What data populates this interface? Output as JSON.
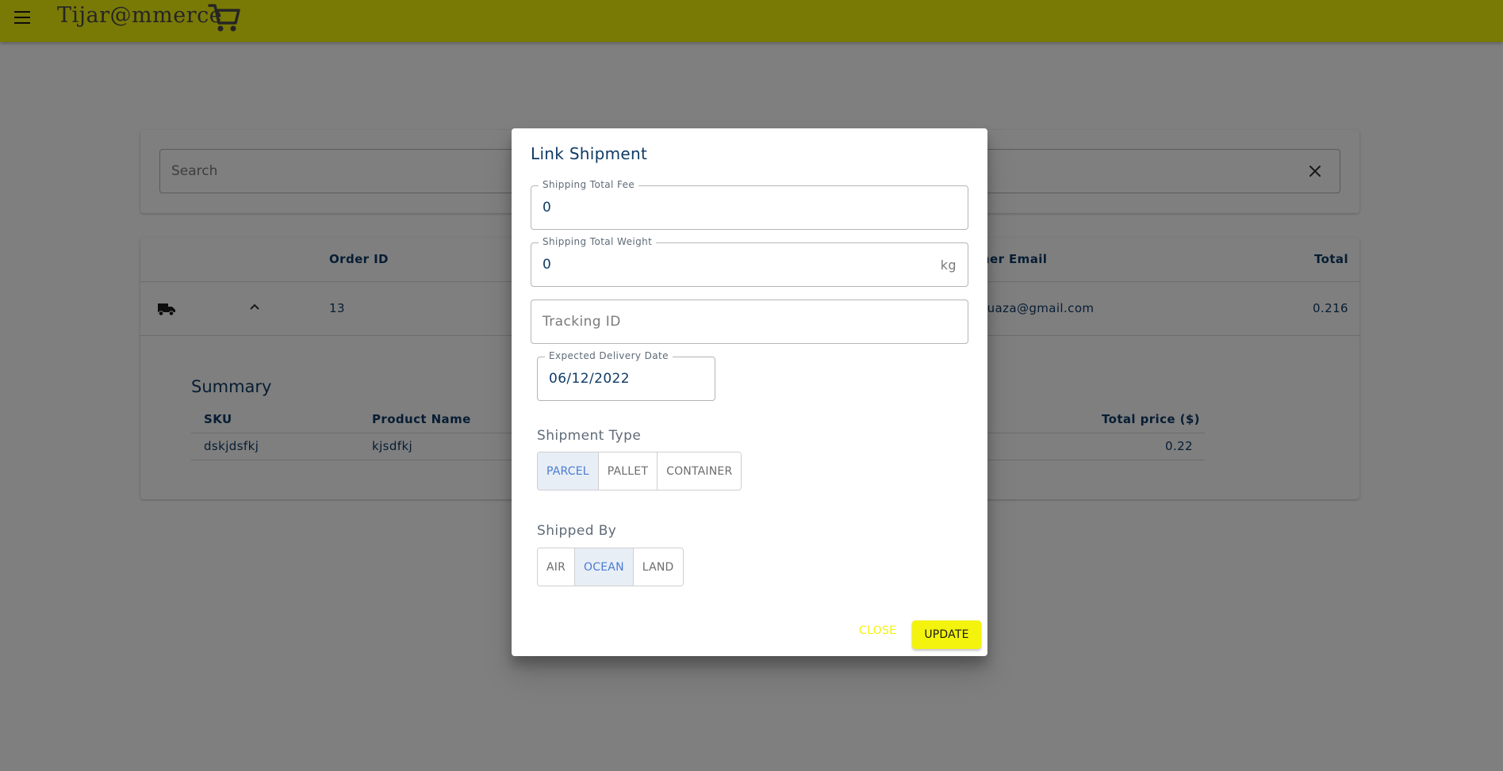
{
  "colors": {
    "brand": "#f3f30d",
    "text": "#0f3b66",
    "selected_toggle": "#4a7bd1"
  },
  "appbar": {
    "logo_text": "Tijar@mmerce",
    "menu_icon": "menu-icon",
    "logo_icon": "shopping-cart-icon"
  },
  "search": {
    "placeholder": "Search",
    "clear_icon": "close-icon"
  },
  "orders_table": {
    "headers": {
      "order_id": "Order ID",
      "customer_email": "mer Email",
      "total": "Total"
    },
    "row": {
      "status_icon": "truck-icon",
      "expand_icon": "chevron-up-icon",
      "order_id": "13",
      "customer_email": "n.bouaza@gmail.com",
      "total": "0.216"
    }
  },
  "summary": {
    "title": "Summary",
    "headers": {
      "sku": "SKU",
      "product_name": "Product Name",
      "total_price": "Total price ($)"
    },
    "row": {
      "sku": "dskjdsfkj",
      "product_name": "kjsdfkj",
      "total_price": "0.22"
    }
  },
  "dialog": {
    "title": "Link Shipment",
    "shipping_fee": {
      "label": "Shipping Total Fee",
      "value": "0"
    },
    "shipping_weight": {
      "label": "Shipping Total Weight",
      "value": "0",
      "unit": "kg"
    },
    "tracking_id": {
      "placeholder": "Tracking ID"
    },
    "delivery_date": {
      "label": "Expected Delivery Date",
      "value": "06/12/2022"
    },
    "shipment_type": {
      "label": "Shipment Type",
      "options": [
        "PARCEL",
        "PALLET",
        "CONTAINER"
      ],
      "selected": "PARCEL"
    },
    "shipped_by": {
      "label": "Shipped By",
      "options": [
        "AIR",
        "OCEAN",
        "LAND"
      ],
      "selected": "OCEAN"
    },
    "close_label": "CLOSE",
    "update_label": "UPDATE"
  }
}
